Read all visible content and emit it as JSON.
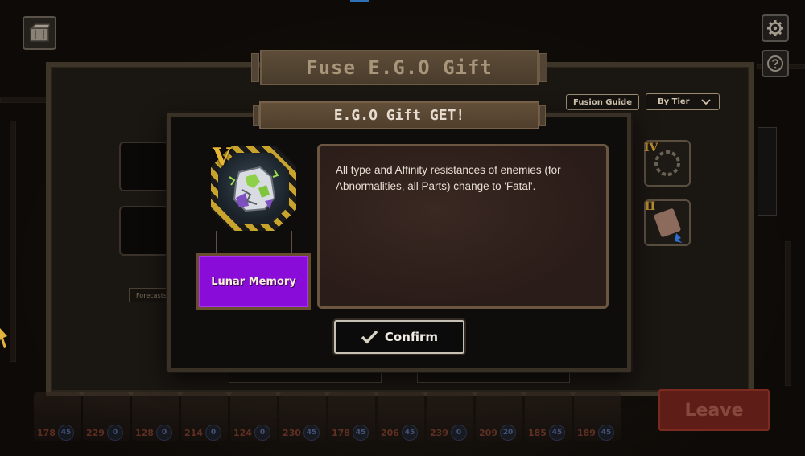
{
  "background": {
    "fuse_title": "Fuse E.G.O Gift",
    "fusion_guide_label": "Fusion Guide",
    "sort_label": "By Tier",
    "forecasts_label": "Forecasts",
    "right_slot_tiers": [
      "IV",
      "II"
    ],
    "leave_label": "Leave",
    "party": [
      {
        "hp": "178",
        "badge": "45"
      },
      {
        "hp": "229",
        "badge": "0"
      },
      {
        "hp": "128",
        "badge": "0"
      },
      {
        "hp": "214",
        "badge": "0"
      },
      {
        "hp": "124",
        "badge": "0"
      },
      {
        "hp": "230",
        "badge": "45"
      },
      {
        "hp": "178",
        "badge": "45"
      },
      {
        "hp": "206",
        "badge": "45"
      },
      {
        "hp": "239",
        "badge": "0"
      },
      {
        "hp": "209",
        "badge": "20"
      },
      {
        "hp": "185",
        "badge": "45"
      },
      {
        "hp": "189",
        "badge": "45"
      }
    ]
  },
  "modal": {
    "title": "E.G.O Gift GET!",
    "gift": {
      "tier": "V",
      "name": "Lunar Memory",
      "name_color": "#8a0cd8",
      "icon": "lunar-memory-gift-icon"
    },
    "description": "All type and Affinity resistances of enemies (for Abnormalities, all Parts) change to 'Fatal'.",
    "confirm_label": "Confirm"
  }
}
